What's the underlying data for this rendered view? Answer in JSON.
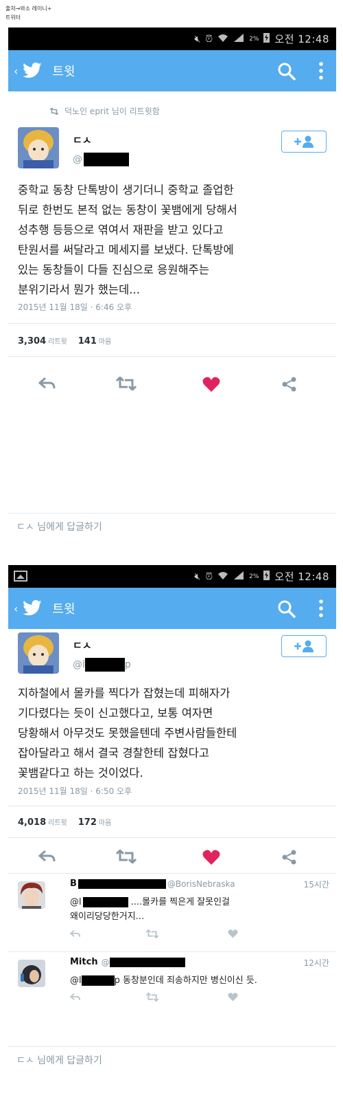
{
  "source_note": {
    "line1": "출처→와소 레이니+",
    "line2": "트위터"
  },
  "status_bar": {
    "battery": "2%",
    "time": "오전 12:48"
  },
  "app_bar": {
    "back": "‹",
    "title": "트윗"
  },
  "tweet1": {
    "retweet_note": "덕노인 eprit 님이 리트윗함",
    "author_name": "ㄷㅅ",
    "handle_prefix": "@",
    "text_lines": [
      "중학교 동창 단톡방이 생기더니 중학교 졸업한",
      "뒤로 한번도 본적 없는 동창이 꽃뱀에게 당해서",
      "성추행 등등으로 엮여서 재판을 받고 있다고",
      "탄원서를 써달라고 메세지를 보냈다. 단톡방에",
      "있는 동창들이 다들 진심으로 응원해주는",
      "분위기라서 뭔가 했는데..."
    ],
    "date": "2015년 11월 18일 · 6:46 오후",
    "retweets": "3,304",
    "retweets_label": "리트윗",
    "likes": "141",
    "likes_label": "마음"
  },
  "reply_bar1": "ㄷㅅ 님에게 답글하기",
  "tweet2": {
    "author_name": "ㄷㅅ",
    "handle_prefix": "@l",
    "handle_suffix": "p",
    "text_lines": [
      "지하철에서 몰카를 찍다가 잡혔는데 피해자가",
      "기다렸다는 듯이 신고했다고, 보통 여자면",
      "당황해서 아무것도 못했을텐데 주변사람들한테",
      "잡아달라고 해서 결국 경찰한테 잡혔다고",
      "꽃뱀같다고 하는 것이었다."
    ],
    "date": "2015년 11월 18일 · 6:50 오후",
    "retweets": "4,018",
    "retweets_label": "리트윗",
    "likes": "172",
    "likes_label": "마음"
  },
  "replies": [
    {
      "name": "B",
      "handle": "@BorisNebraska",
      "time": "15시간",
      "line1_prefix": "@l",
      "line1_suffix": "....몰카를 찍은게 잘못인걸",
      "line2": "왜이리당당한거지..."
    },
    {
      "name": "Mitch",
      "handle": "@",
      "time": "12시간",
      "line1_prefix": "@l",
      "line1_suffix": "p 동창분인데 죄송하지만 병신이신 듯."
    }
  ],
  "reply_bar2": "ㄷㅅ 님에게 답글하기",
  "colors": {
    "twitter_blue": "#55acee",
    "like_red": "#e0245e",
    "action_gray": "#8899a6"
  },
  "icons": [
    "back-icon",
    "twitter-bird-icon",
    "search-icon",
    "more-icon",
    "retweet-icon",
    "follow-icon",
    "reply-icon",
    "heart-icon",
    "share-icon",
    "mute-icon",
    "alarm-icon",
    "wifi-icon",
    "signal-icon",
    "battery-icon",
    "gallery-icon"
  ]
}
